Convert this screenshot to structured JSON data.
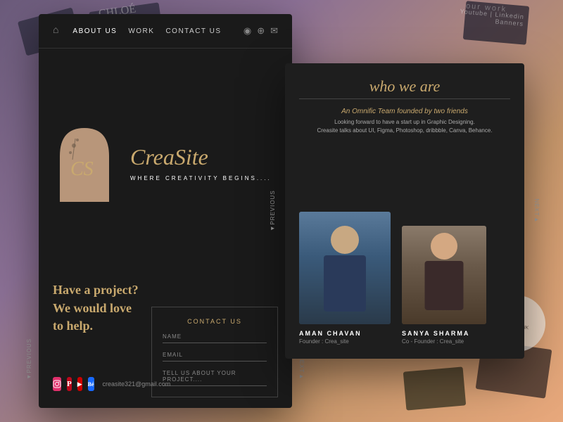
{
  "background": {
    "bg_text_1": "CHLOÉ",
    "bg_text_2": "our work",
    "bg_text_yw": "Youtube | Linkedin\nBanners",
    "bg_dip_text": "DIP\nYOUR INK"
  },
  "nav": {
    "home_icon": "⌂",
    "links": [
      "ABOUT US",
      "WORK",
      "CONTACT US"
    ],
    "social_icons": [
      "📷",
      "📌",
      "✉"
    ]
  },
  "hero": {
    "brand_name": "CreaSite",
    "tagline": "WHERE CREATIVITY BEGINS....",
    "logo_letters": "CS"
  },
  "contact_section": {
    "promo_text": "Have a project?\nWe would love\nto help.",
    "form_title": "CONTACT US",
    "fields": [
      {
        "label": "NAME"
      },
      {
        "label": "EMAIL"
      },
      {
        "label": "TELL US ABOUT YOUR PROJECT...."
      }
    ]
  },
  "social": {
    "email": "creasite321@gmail.com",
    "icons": [
      "ig",
      "pi",
      "yt",
      "be"
    ]
  },
  "side_labels": {
    "previous": "◄Previous",
    "next": "Next►"
  },
  "about": {
    "title": "who we are",
    "tagline": "An Omnific Team founded by two friends",
    "description": "Looking forward to have a start up in Graphic Designing.\nCreasite talks about UI, Figma, Photoshop, dribbble, Canva, Behance.",
    "members": [
      {
        "name": "AMAN CHAVAN",
        "role": "Founder : Crea_site"
      },
      {
        "name": "SANYA SHARMA",
        "role": "Co - Founder : Crea_site"
      }
    ]
  }
}
